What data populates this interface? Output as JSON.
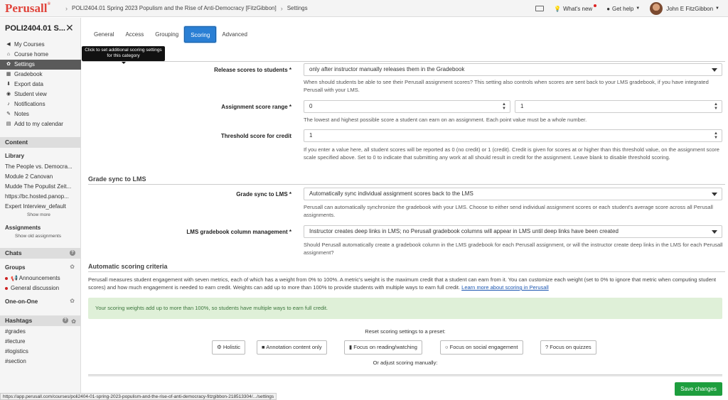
{
  "topbar": {
    "logo": "Perusall",
    "breadcrumb_course": "POLI2404.01 Spring 2023 Populism and the Rise of Anti-Democracy [FitzGibbon]",
    "breadcrumb_page": "Settings",
    "whats_new": "What's new",
    "get_help": "Get help",
    "user_name": "John E FitzGibbon"
  },
  "sidebar": {
    "course_title": "POLI2404.01 S...",
    "nav": [
      {
        "label": "My Courses",
        "icon": "arrow-left-icon"
      },
      {
        "label": "Course home",
        "icon": "home-icon"
      },
      {
        "label": "Settings",
        "icon": "gear-icon"
      },
      {
        "label": "Gradebook",
        "icon": "table-icon"
      },
      {
        "label": "Export data",
        "icon": "export-icon"
      },
      {
        "label": "Student view",
        "icon": "eye-icon"
      },
      {
        "label": "Notifications",
        "icon": "bell-icon"
      },
      {
        "label": "Notes",
        "icon": "pencil-icon"
      },
      {
        "label": "Add to my calendar",
        "icon": "calendar-icon"
      }
    ],
    "content_header": "Content",
    "library_label": "Library",
    "library_items": [
      "The People vs. Democra...",
      "Module 2 Canovan",
      "Mudde The Populist Zeit...",
      "https://bc.hosted.panop...",
      "Expert Interview_default"
    ],
    "show_more": "Show more",
    "assignments_label": "Assignments",
    "show_old_assignments": "Show old assignments",
    "chats_header": "Chats",
    "groups_label": "Groups",
    "group_items": [
      "Announcements",
      "General discussion"
    ],
    "one_on_one": "One-on-One",
    "hashtags_header": "Hashtags",
    "hashtags": [
      "#grades",
      "#lecture",
      "#logistics",
      "#section"
    ]
  },
  "tabs": [
    "General",
    "Access",
    "Grouping",
    "Scoring",
    "Advanced"
  ],
  "tooltip": "Click to set additional scoring settings for this category",
  "release": {
    "label": "Release scores to students *",
    "value": "only after instructor manually releases them in the Gradebook",
    "help": "When should students be able to see their Perusall assignment scores? This setting also controls when scores are sent back to your LMS gradebook, if you have integrated Perusall with your LMS."
  },
  "range": {
    "label": "Assignment score range *",
    "min": "0",
    "max": "1",
    "help": "The lowest and highest possible score a student can earn on an assignment. Each point value must be a whole number."
  },
  "threshold": {
    "label": "Threshold score for credit",
    "value": "1",
    "help": "If you enter a value here, all student scores will be reported as 0 (no credit) or 1 (credit). Credit is given for scores at or higher than this threshold value, on the assignment score scale specified above. Set to 0 to indicate that submitting any work at all should result in credit for the assignment. Leave blank to disable threshold scoring."
  },
  "grade_sync_section": "Grade sync to LMS",
  "grade_sync": {
    "label": "Grade sync to LMS *",
    "value": "Automatically sync individual assignment scores back to the LMS",
    "help": "Perusall can automatically synchronize the gradebook with your LMS. Choose to either send individual assignment scores or each student's average score across all Perusall assignments."
  },
  "column_mgmt": {
    "label": "LMS gradebook column management *",
    "value": "Instructor creates deep links in LMS; no Perusall gradebook columns will appear in LMS until deep links have been created",
    "help": "Should Perusall automatically create a gradebook column in the LMS gradebook for each Perusall assignment, or will the instructor create deep links in the LMS for each Perusall assignment?"
  },
  "auto_section": "Automatic scoring criteria",
  "auto_text": "Perusall measures student engagement with seven metrics, each of which has a weight from 0% to 100%. A metric's weight is the maximum credit that a student can earn from it. You can customize each weight (set to 0% to ignore that metric when computing student scores) and how much engagement is needed to earn credit. Weights can add up to more than 100% to provide students with multiple ways to earn full credit.",
  "auto_link": "Learn more about scoring in Perusall",
  "info": "Your scoring weights add up to more than 100%, so students have multiple ways to earn full credit.",
  "reset_label": "Reset scoring settings to a preset:",
  "presets": [
    "Holistic",
    "Annotation content only",
    "Focus on reading/watching",
    "Focus on social engagement",
    "Focus on quizzes"
  ],
  "adjust_label": "Or adjust scoring manually:",
  "status_url": "https://app.perusall.com/courses/poli2404-01-spring-2023-populism-and-the-rise-of-anti-democracy-fitzgibbon-218513304/.../settings",
  "save_label": "Save changes"
}
